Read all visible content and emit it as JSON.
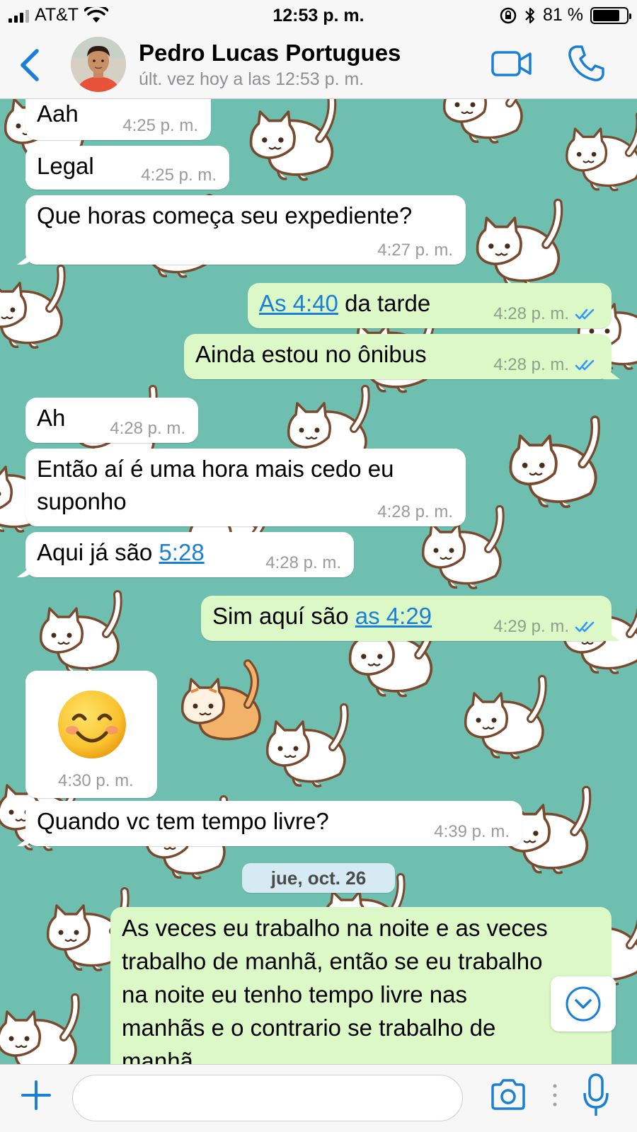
{
  "status_bar": {
    "carrier": "AT&T",
    "time": "12:53 p. m.",
    "battery": "81 %",
    "battery_level": 0.81
  },
  "header": {
    "contact_name": "Pedro Lucas Portugues",
    "last_seen": "últ. vez hoy a las 12:53 p. m."
  },
  "messages": [
    {
      "direction": "in",
      "text": "Aah",
      "time": "4:25 p. m."
    },
    {
      "direction": "in",
      "text": "Legal",
      "time": "4:25 p. m."
    },
    {
      "direction": "in",
      "text": "Que horas começa seu expediente?",
      "time": "4:27 p. m."
    },
    {
      "direction": "out",
      "link": "As 4:40",
      "text": " da tarde",
      "time": "4:28 p. m.",
      "status": "read"
    },
    {
      "direction": "out",
      "text": "Ainda estou no ônibus",
      "time": "4:28 p. m.",
      "status": "read"
    },
    {
      "direction": "in",
      "text": "Ah",
      "time": "4:28 p. m."
    },
    {
      "direction": "in",
      "line1": "Então aí é uma hora mais cedo eu",
      "line2": "suponho",
      "time": "4:28 p. m."
    },
    {
      "direction": "in",
      "text": "Aqui já são ",
      "link": "5:28",
      "time": "4:28 p. m."
    },
    {
      "direction": "out",
      "text": "Sim aquí são ",
      "link": "as 4:29",
      "time": "4:29 p. m.",
      "status": "read"
    },
    {
      "direction": "in",
      "emoji": "smiling-face-with-smiling-eyes",
      "time": "4:30 p. m."
    },
    {
      "direction": "in",
      "text": "Quando vc tem tempo livre?",
      "time": "4:39 p. m."
    }
  ],
  "date_separator": "jue, oct. 26",
  "last_message": {
    "direction": "out",
    "lines": [
      "As veces eu trabalho na noite e as veces",
      "trabalho de manhã, então se eu trabalho",
      "na noite eu tenho tempo livre nas",
      "manhãs e o contrario se trabalho de",
      "manhã"
    ]
  },
  "input_bar": {
    "placeholder": ""
  },
  "colors": {
    "accent": "#1a7fd6",
    "incoming_bubble": "#ffffff",
    "outgoing_bubble": "#dcf8c6",
    "wallpaper": "#6fbfb1",
    "read_ticks": "#3497f9"
  },
  "icons": [
    "back-chevron-icon",
    "video-call-icon",
    "phone-icon",
    "plus-icon",
    "camera-icon",
    "microphone-icon",
    "chevron-down-icon",
    "double-check-icon"
  ]
}
